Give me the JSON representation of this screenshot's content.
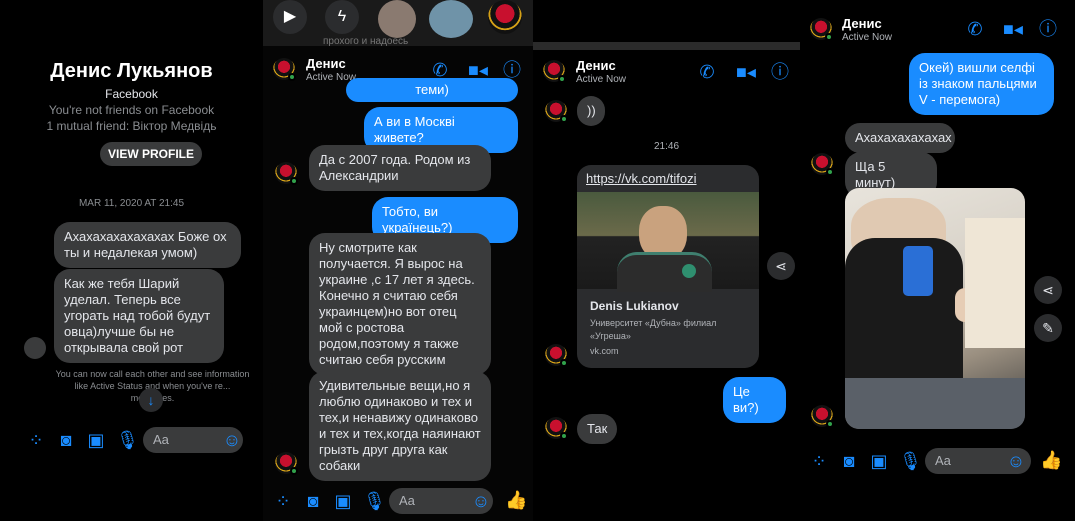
{
  "contact": {
    "name": "Денис",
    "status": "Active Now"
  },
  "p1": {
    "profile_name": "Денис Лукьянов",
    "profile_source": "Facebook",
    "not_friends": "You're not friends on Facebook",
    "mutual": "1 mutual friend: Віктор Медвідь",
    "view_profile": "VIEW PROFILE",
    "timestamp": "MAR 11, 2020 AT 21:45",
    "msg1": "Ахахахахахахахах Боже ох ты и недалекая умом)",
    "msg2": "Как же тебя Шарий уделал. Теперь все угорать над тобой будут овца)лучше бы не открывала свой рот",
    "notice": "You can now call each other and see information like Active Status and when you've re... messages.",
    "composer_placeholder": "Aa"
  },
  "p2": {
    "top_text": "прохого и надоесь",
    "msg_top_partial": "теми)",
    "msg_out1": "А ви в Москві живете?",
    "msg_in1": "Да с 2007 года. Родом из Александрии",
    "msg_out2": "Тобто, ви українець?)",
    "msg_in2": "Ну смотрите как получается. Я вырос на украине ,с 17 лет я здесь. Конечно я считаю себя украинцем)но вот отец мой с ростова родом,поэтому я также считаю себя русским",
    "msg_in3": "Удивительные вещи,но я люблю одинаково и тех и тех,и ненавижу одинаково и тех и тех,когда наяинают грызть друг друга  как собаки",
    "composer_placeholder": "Aa"
  },
  "p3": {
    "msg_in0": "))",
    "time": "21:46",
    "link_url": "https://vk.com/tifozi",
    "link_title": "Denis Lukianov",
    "link_desc": "Университет «Дубна» филиал «Угреша»",
    "link_domain": "vk.com",
    "msg_out": "Це ви?)",
    "msg_in": "Так"
  },
  "p4": {
    "msg_out": "Окей) вишли селфі із знаком пальцями V - перемога)",
    "msg_in1": "Ахахахахахахах",
    "msg_in2": "Ща 5 минут)",
    "composer_placeholder": "Aa"
  },
  "icons": {
    "phone": "phone-icon",
    "video": "video-icon",
    "info": "info-icon",
    "accent": "#1a8cff",
    "online": "#31a24c"
  }
}
